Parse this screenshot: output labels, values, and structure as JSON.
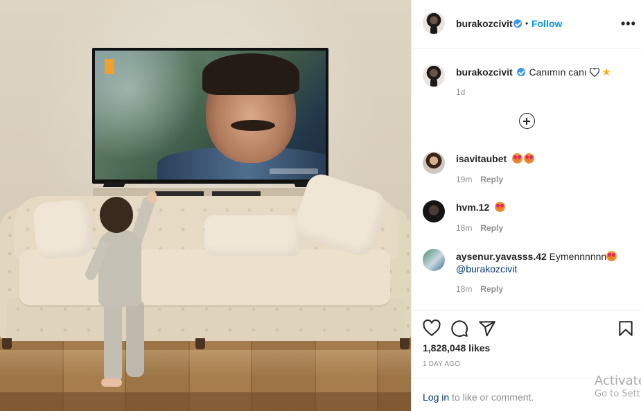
{
  "post": {
    "author": "burakozcivit",
    "follow_label": "Follow",
    "separator": "•",
    "more_label": "•••"
  },
  "caption": {
    "username": "burakozcivit",
    "text": "Canımın canı",
    "time": "1d"
  },
  "comments": [
    {
      "username": "isavitaubet",
      "text": "",
      "time": "19m",
      "reply_label": "Reply"
    },
    {
      "username": "hvm.12",
      "text": "",
      "time": "18m",
      "reply_label": "Reply"
    },
    {
      "username": "aysenur.yavasss.42",
      "text": "Eymennnnnn",
      "mention": "@burakozcivit",
      "time": "18m",
      "reply_label": "Reply"
    }
  ],
  "stats": {
    "likes": "1,828,048 likes",
    "posted": "1 DAY AGO"
  },
  "footer": {
    "login_link": "Log in",
    "login_rest": " to like or comment."
  },
  "watermark": {
    "line1": "Activate",
    "line2": "Go to Sett"
  },
  "icons": [
    "more-options-icon",
    "verified-badge-icon",
    "heart-icon",
    "comment-icon",
    "share-icon",
    "bookmark-icon",
    "load-more-comments-icon",
    "star-emoji",
    "heart-eyes-emoji"
  ],
  "colors": {
    "link_blue": "#0095f6",
    "verified_blue": "#3897f0",
    "mention_blue": "#00376b",
    "muted_gray": "#8e8e8e",
    "text_dark": "#262626"
  }
}
